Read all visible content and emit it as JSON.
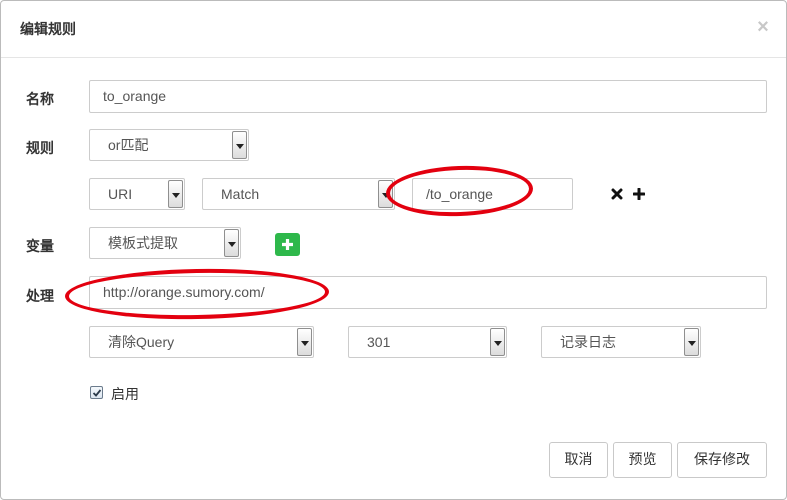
{
  "dialog": {
    "title": "编辑规则",
    "close_symbol": "×"
  },
  "form": {
    "name": {
      "label": "名称",
      "value": "to_orange"
    },
    "rule": {
      "label": "规则",
      "type": "or匹配",
      "condition": {
        "type": "URI",
        "operator": "Match",
        "value": "/to_orange"
      },
      "delete_icon": "times-icon",
      "add_icon": "plus-icon"
    },
    "variable": {
      "label": "变量",
      "extract_type": "模板式提取",
      "add_icon": "plus-icon",
      "add_color": "#2eb84b"
    },
    "handle": {
      "label": "处理",
      "url": "http://orange.sumory.com/",
      "query_option": "清除Query",
      "status_code": "301",
      "log_option": "记录日志"
    },
    "enable": {
      "label": "启用",
      "checked": true
    }
  },
  "footer": {
    "cancel_label": "取消",
    "preview_label": "预览",
    "save_label": "保存修改"
  },
  "annotation_color": "#e3000f"
}
